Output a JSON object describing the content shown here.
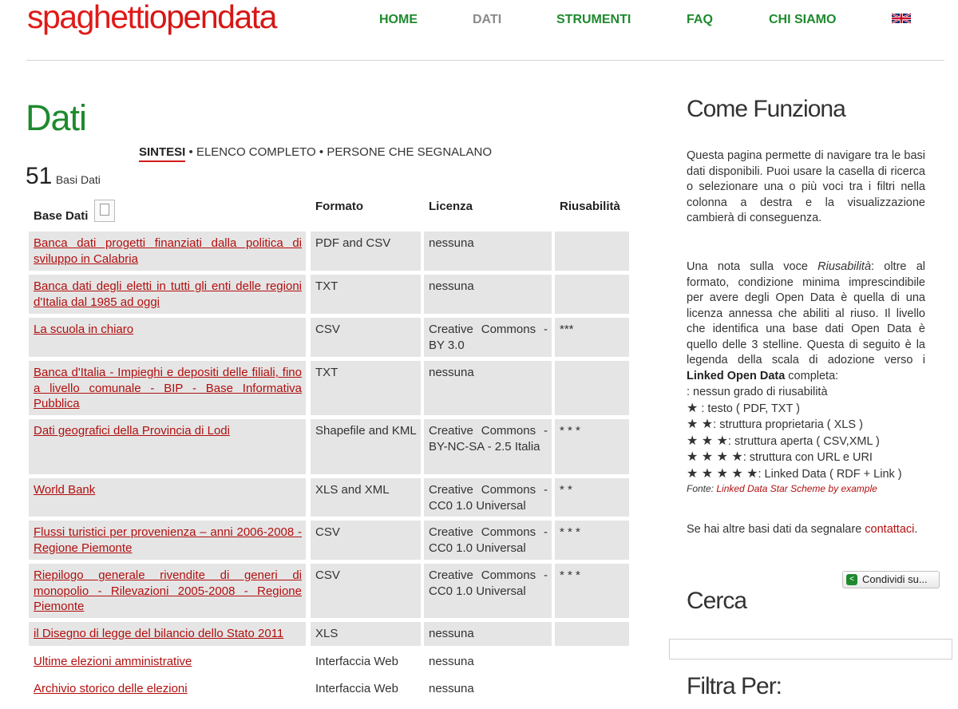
{
  "site": {
    "logo_part1": "spaghetti",
    "logo_part2": "opendata"
  },
  "nav": {
    "home": "HOME",
    "dati": "DATI",
    "strumenti": "STRUMENTI",
    "faq": "FAQ",
    "chi_siamo": "CHI SIAMO",
    "language_icon": "uk-flag-icon"
  },
  "page": {
    "title": "Dati",
    "subnav": {
      "sintesi": "SINTESI",
      "sep": " • ",
      "elenco": "ELENCO COMPLETO",
      "persone": "PERSONE CHE SEGNALANO"
    },
    "count_number": "51",
    "count_label": "Basi Dati"
  },
  "table": {
    "headers": {
      "base": "Base Dati",
      "formato": "Formato",
      "licenza": "Licenza",
      "riusabilita": "Riusabilità"
    },
    "rows": [
      {
        "name": "Banca dati progetti finanziati dalla politica di sviluppo in Calabria",
        "formato": "PDF and CSV",
        "licenza": "nessuna",
        "riusabilita": ""
      },
      {
        "name": "Banca dati degli eletti in tutti gli enti delle regioni d'Italia dal 1985 ad oggi",
        "formato": "TXT",
        "licenza": "nessuna",
        "riusabilita": ""
      },
      {
        "name": "La scuola in chiaro",
        "formato": "CSV",
        "licenza": "Creative Commons - BY 3.0",
        "riusabilita": "***"
      },
      {
        "name": "Banca d'Italia - Impieghi e depositi delle filiali, fino a livello comunale - BIP - Base Informativa Pubblica",
        "formato": "TXT",
        "licenza": "nessuna",
        "riusabilita": ""
      },
      {
        "name": "Dati geografici della Provincia di Lodi",
        "formato": "Shapefile and KML",
        "licenza": "Creative Commons - BY-NC-SA - 2.5 Italia",
        "riusabilita": "* * *"
      },
      {
        "name": "World Bank",
        "formato": "XLS and XML",
        "licenza": "Creative Commons - CC0 1.0 Universal",
        "riusabilita": "* *"
      },
      {
        "name": "Flussi turistici per provenienza – anni 2006-2008 - Regione Piemonte",
        "formato": "CSV",
        "licenza": "Creative Commons - CC0 1.0 Universal",
        "riusabilita": "* * *"
      },
      {
        "name": "Riepilogo generale rivendite di generi di monopolio - Rilevazioni 2005-2008 - Regione Piemonte",
        "formato": "CSV",
        "licenza": "Creative Commons - CC0 1.0 Universal",
        "riusabilita": "* * *"
      },
      {
        "name": "il Disegno di legge del bilancio dello Stato 2011",
        "formato": "XLS",
        "licenza": "nessuna",
        "riusabilita": ""
      },
      {
        "name": "Ultime elezioni amministrative",
        "formato": "Interfaccia Web",
        "licenza": "nessuna",
        "riusabilita": ""
      },
      {
        "name": "Archivio storico delle elezioni",
        "formato": "Interfaccia Web",
        "licenza": "nessuna",
        "riusabilita": ""
      }
    ]
  },
  "sidebar": {
    "come_funziona_title": "Come Funziona",
    "intro": "Questa pagina permette di navigare tra le basi dati disponibili. Puoi usare la casella di ricerca o selezionare una o più voci tra i filtri nella colonna a destra e la visualizzazione cambierà di conseguenza.",
    "nota_pre": "Una nota sulla voce ",
    "nota_term": "Riusabilità",
    "nota_mid": ": oltre al formato, condizione minima imprescindibile per avere degli Open Data è quella di una licenza annessa che abiliti al riuso. Il livello che identifica una base dati Open Data è quello delle 3 stelline. Questa di seguito è la legenda della scala di adozione verso i ",
    "nota_bold": "Linked Open Data",
    "nota_end": " completa:",
    "legend": [
      {
        "stars": "",
        "text": ": nessun grado di riusabilità"
      },
      {
        "stars": "★",
        "text": " : testo ( PDF, TXT )"
      },
      {
        "stars": "★ ★",
        "text": ": struttura proprietaria ( XLS )"
      },
      {
        "stars": "★ ★ ★",
        "text": ": struttura aperta ( CSV,XML )"
      },
      {
        "stars": "★ ★ ★ ★",
        "text": ": struttura con URL e URI"
      },
      {
        "stars": "★ ★ ★ ★ ★",
        "text": ": Linked Data ( RDF + Link )"
      }
    ],
    "fonte_label": "Fonte: ",
    "fonte_link": "Linked Data Star Scheme by example",
    "segnalare_text": "Se hai altre basi dati da segnalare ",
    "contattaci": "contattaci",
    "segnalare_end": ".",
    "share_label": "Condividi su...",
    "cerca_title": "Cerca",
    "filtra_title": "Filtra Per:"
  },
  "colors": {
    "logo_red": "#e01a1a",
    "nav_green": "#1e8a2e",
    "link_red": "#b20f0f",
    "row_gray": "#e5e5e5"
  }
}
